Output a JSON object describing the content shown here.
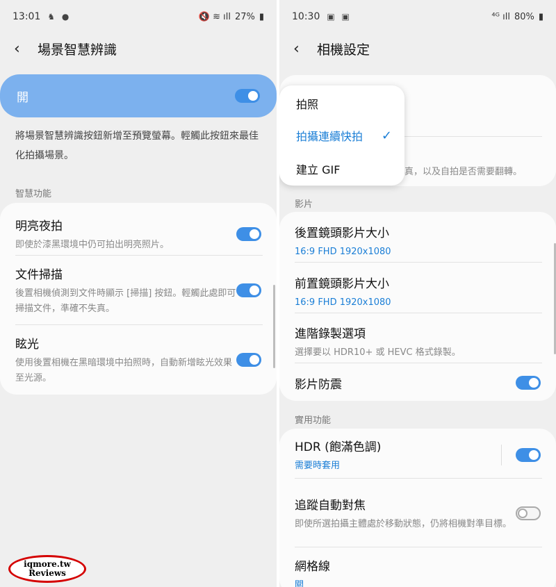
{
  "left": {
    "status": {
      "time": "13:01",
      "icons_left": "♞ ●",
      "icons_right": "🔇 ≋ ıll",
      "battery": "27%"
    },
    "title": "場景智慧辨識",
    "master": {
      "label": "開",
      "on": true
    },
    "description": "將場景智慧辨識按鈕新增至預覽螢幕。輕觸此按鈕來最佳化拍攝場景。",
    "section": "智慧功能",
    "items": [
      {
        "title": "明亮夜拍",
        "subtitle": "即使於漆黑環境中仍可拍出明亮照片。",
        "on": true
      },
      {
        "title": "文件掃描",
        "subtitle": "後置相機偵測到文件時顯示 [掃描] 按鈕。輕觸此處即可掃描文件，準確不失真。",
        "on": true
      },
      {
        "title": "眩光",
        "subtitle": "使用後置相機在黑暗環境中拍照時，自動新增眩光效果至光源。",
        "on": true
      }
    ]
  },
  "right": {
    "status": {
      "time": "10:30",
      "icons_left": "▣ ▣",
      "icons_right": "⁴ᴳ ıll",
      "battery": "80%"
    },
    "title": "相機設定",
    "dropdown": {
      "options": [
        "拍照",
        "拍攝連續快拍",
        "建立 GIF"
      ],
      "selected_index": 1
    },
    "behind_dropdown_text": "真，以及自拍是否需要翻轉。",
    "section_video": "影片",
    "video_items": [
      {
        "title": "後置鏡頭影片大小",
        "subtitle": "16:9 FHD 1920x1080"
      },
      {
        "title": "前置鏡頭影片大小",
        "subtitle": "16:9 FHD 1920x1080"
      },
      {
        "title": "進階錄製選項",
        "subtitle": "選擇要以 HDR10+ 或 HEVC 格式錄製。"
      },
      {
        "title": "影片防震",
        "on": true
      }
    ],
    "section_useful": "實用功能",
    "useful_items": [
      {
        "title": "HDR (飽滿色調)",
        "subtitle": "需要時套用",
        "on": true
      },
      {
        "title": "追蹤自動對焦",
        "subtitle": "即使所選拍攝主體處於移動狀態，仍將相機對準目標。",
        "on": false
      },
      {
        "title": "網格線",
        "subtitle": "關"
      }
    ]
  },
  "watermark": {
    "line1": "iqmore.tw",
    "line2": "Reviews"
  },
  "colors": {
    "accent": "#3e8fe6",
    "master_bg": "#7cb1ee",
    "link_blue": "#1a7ed6"
  }
}
